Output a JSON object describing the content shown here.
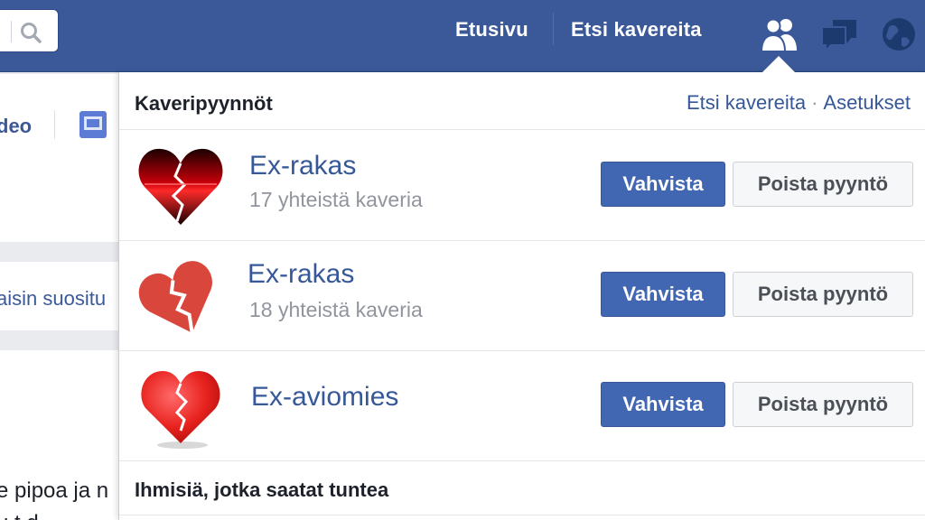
{
  "topbar": {
    "search_icon": "search-icon",
    "nav": {
      "home": "Etusivu",
      "find_friends": "Etsi kavereita"
    },
    "jewels": [
      "friends-icon",
      "messages-icon",
      "notifications-icon"
    ],
    "color": "#3b5998"
  },
  "background": {
    "video_text": "deo",
    "recent_text": "aisin suositu",
    "post_line_1": "e pipoa ja n",
    "post_line_2": "u   t   d"
  },
  "friend_requests": {
    "title": "Kaveripyynnöt",
    "link_find": "Etsi kavereita",
    "link_separator": "·",
    "link_settings": "Asetukset",
    "confirm_label": "Vahvista",
    "delete_label": "Poista pyyntö",
    "items": [
      {
        "name": "Ex-rakas",
        "mutual": "17 yhteistä kaveria",
        "avatar": "red-black-broken-heart-icon"
      },
      {
        "name": "Ex-rakas",
        "mutual": "18 yhteistä kaveria",
        "avatar": "torn-paper-heart-icon"
      },
      {
        "name": "Ex-aviomies",
        "mutual": "",
        "avatar": "cracked-red-heart-icon"
      }
    ],
    "footer_title": "Ihmisiä, jotka saatat tuntea"
  }
}
